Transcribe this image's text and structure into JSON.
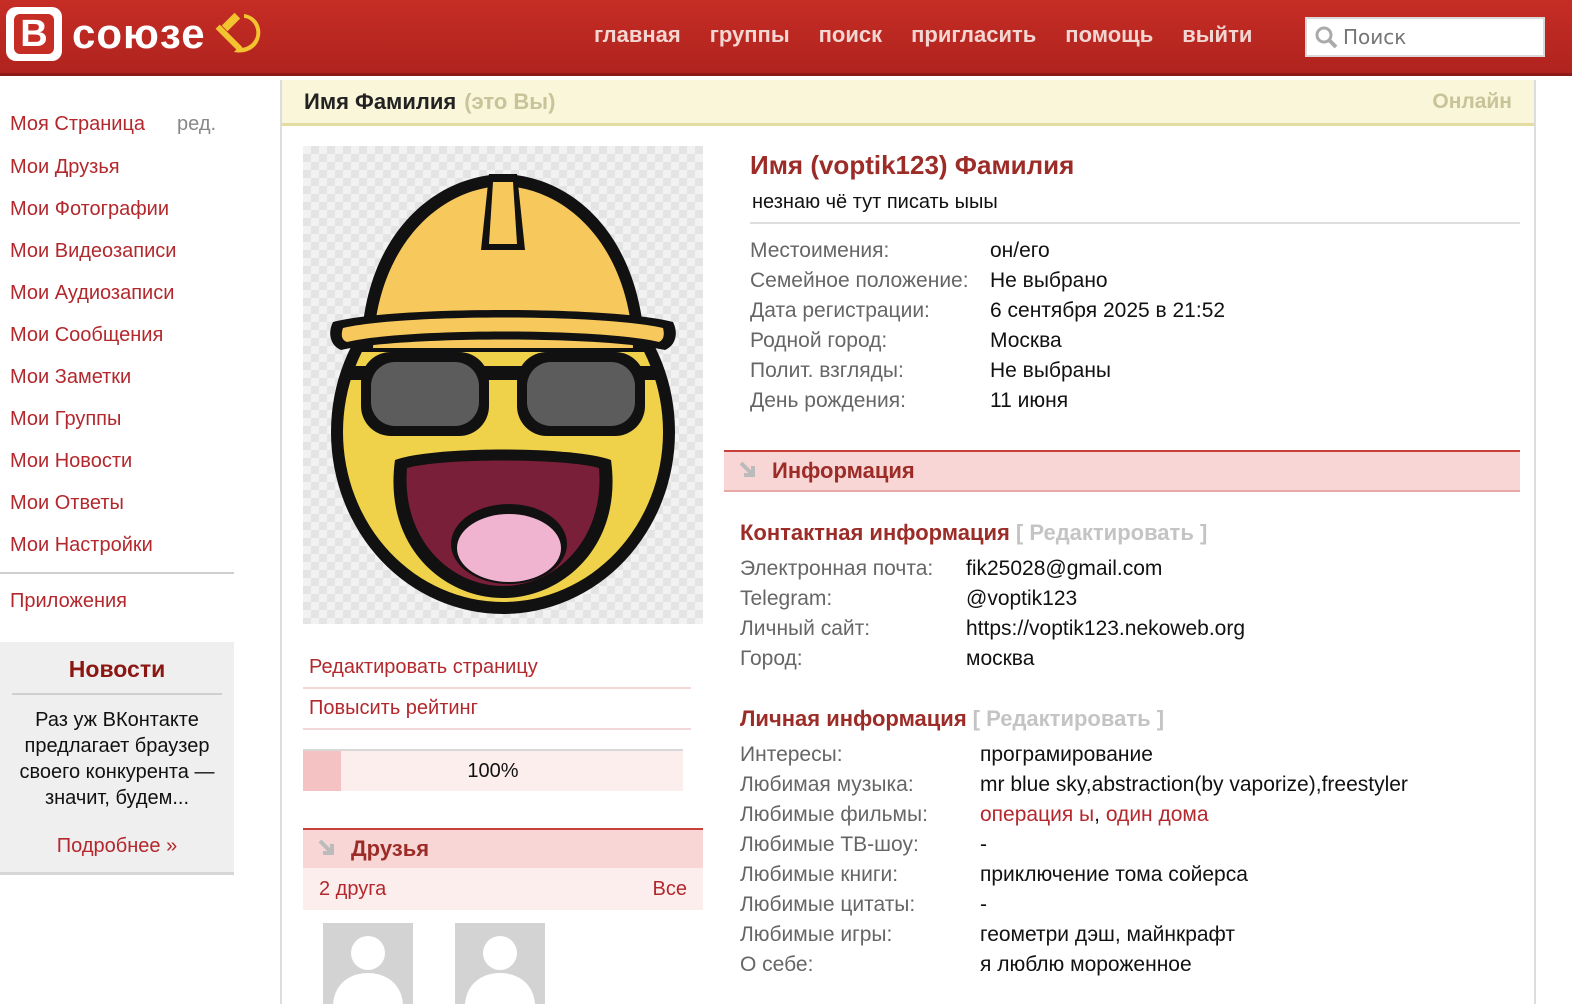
{
  "header": {
    "logo_letter": "В",
    "logo_text": "союзе",
    "nav": [
      "главная",
      "группы",
      "поиск",
      "пригласить",
      "помощь",
      "выйти"
    ],
    "search_placeholder": "Поиск"
  },
  "sidebar": {
    "items": [
      {
        "label": "Моя Страница",
        "extra": "ред."
      },
      {
        "label": "Мои Друзья"
      },
      {
        "label": "Мои Фотографии"
      },
      {
        "label": "Мои Видеозаписи"
      },
      {
        "label": "Мои Аудиозаписи"
      },
      {
        "label": "Мои Сообщения"
      },
      {
        "label": "Мои Заметки"
      },
      {
        "label": "Мои Группы"
      },
      {
        "label": "Мои Новости"
      },
      {
        "label": "Мои Ответы"
      },
      {
        "label": "Мои Настройки"
      }
    ],
    "apps": "Приложения",
    "news": {
      "title": "Новости",
      "text": "Раз уж ВКонтакте предлагает браузер своего конкурента — значит, будем...",
      "more": "Подробнее »"
    }
  },
  "titlebar": {
    "name": "Имя Фамилия",
    "you": "(это Вы)",
    "online": "Онлайн"
  },
  "actions": {
    "edit_page": "Редактировать страницу",
    "raise_rating": "Повысить рейтинг"
  },
  "rating": {
    "percent_label": "100%",
    "fill_fraction": 0.1
  },
  "friends": {
    "title": "Друзья",
    "count": "2 друга",
    "all": "Все"
  },
  "profile": {
    "name": "Имя (voptik123) Фамилия",
    "status": "незнаю чё тут писать ыыы",
    "fields": [
      {
        "k": "Местоимения:",
        "v": "он/его",
        "link": false
      },
      {
        "k": "Семейное положение:",
        "v": "Не выбрано",
        "link": false
      },
      {
        "k": "Дата регистрации:",
        "v": "6 сентября 2025 в 21:52",
        "link": false
      },
      {
        "k": "Родной город:",
        "v": "Москва",
        "link": true
      },
      {
        "k": "Полит. взгляды:",
        "v": "Не выбраны",
        "link": false
      },
      {
        "k": "День рождения:",
        "v": "11 июня",
        "link": false
      }
    ]
  },
  "info": {
    "title": "Информация",
    "contact": {
      "title": "Контактная информация",
      "edit": "[ Редактировать ]",
      "fields": [
        {
          "k": "Электронная почта:",
          "v": "fik25028@gmail.com"
        },
        {
          "k": "Telegram:",
          "v": "@voptik123"
        },
        {
          "k": "Личный сайт:",
          "v": "https://voptik123.nekoweb.org"
        },
        {
          "k": "Город:",
          "v": "москва"
        }
      ]
    },
    "personal": {
      "title": "Личная информация",
      "edit": "[ Редактировать ]",
      "interests_k": "Интересы:",
      "interests_v": "програмирование",
      "music_k": "Любимая музыка:",
      "music_v": "mr blue sky,abstraction(by vaporize),freestyler",
      "films_k": "Любимые фильмы:",
      "film1": "операция ы",
      "film_sep": ",",
      "film2": "один дома",
      "tv_k": "Любимые ТВ-шоу:",
      "tv_v": "-",
      "books_k": "Любимые книги:",
      "books_v": "приключение тома сойерса",
      "quotes_k": "Любимые цитаты:",
      "quotes_v": "-",
      "games_k": "Любимые игры:",
      "games_v": "геометри дэш, майнкрафт",
      "about_k": "О себе:",
      "about_v": "я люблю мороженное"
    }
  },
  "colors": {
    "brand": "#c52d25",
    "link": "#b3282d",
    "section_bg": "#f9d6d6"
  }
}
